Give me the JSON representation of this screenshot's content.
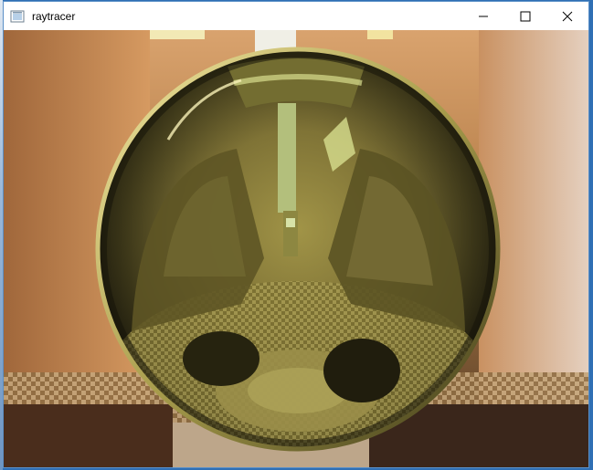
{
  "window": {
    "title": "raytracer",
    "icon": "app-window-icon"
  },
  "controls": {
    "minimize_icon": "minimize-icon",
    "maximize_icon": "maximize-icon",
    "close_icon": "close-icon"
  },
  "colors": {
    "accent": "#0078d7",
    "sphere_gold": "#c7b94a"
  }
}
